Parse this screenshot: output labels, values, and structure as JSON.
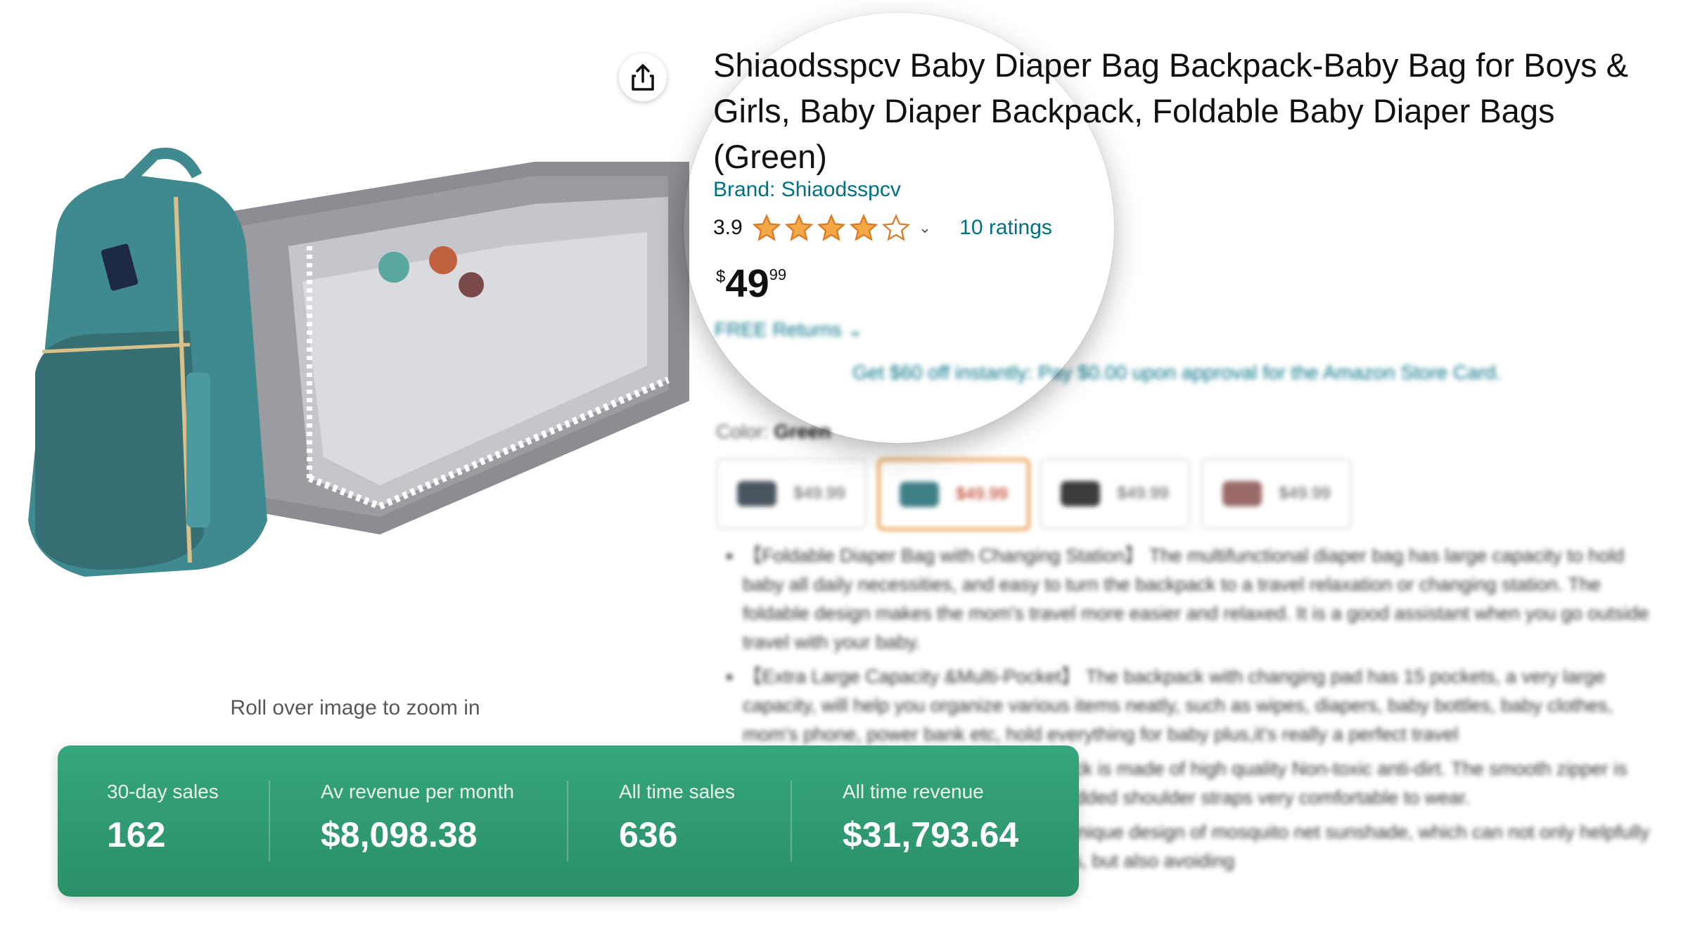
{
  "product": {
    "title": "Shiaodsspcv Baby Diaper Bag Backpack-Baby Bag for Boys & Girls, Baby Diaper Backpack, Foldable Baby Diaper Bags (Green)",
    "brand": "Brand: Shiaodsspcv",
    "rating": {
      "value": "3.9",
      "stars": 3.9,
      "ratings_count": "10 ratings",
      "caret": "⌄"
    },
    "price": {
      "symbol": "$",
      "whole": "49",
      "fraction": "99"
    },
    "free_returns": "FREE Returns ⌄",
    "store_card_offer": "Get $60 off instantly: Pay $0.00 upon approval for the Amazon Store Card.",
    "color_label": "Color:",
    "color_value": "Green",
    "swatches": [
      {
        "price": "$49.99",
        "color": "#4a5560",
        "selected": false
      },
      {
        "price": "$49.99",
        "color": "#3f7f86",
        "selected": true
      },
      {
        "price": "$49.99",
        "color": "#3c3c3c",
        "selected": false
      },
      {
        "price": "$49.99",
        "color": "#9a6a6a",
        "selected": false
      }
    ],
    "bullets": [
      "【Foldable Diaper Bag with Changing Station】 The multifunctional diaper bag has large capacity to hold baby all daily necessities, and easy to turn the backpack to a travel relaxation or changing station. The foldable design makes the mom's travel more easier and relaxed. It is a good assistant when you go outside travel with your baby.",
      "【Extra Large Capacity &Multi-Pocket】 The backpack with changing pad has 15 pockets, a very large capacity, will help you organize various items neatly, such as wipes, diapers, baby bottles, baby clothes, mom's phone, power bank etc, hold everything for baby plus,it's really a perfect travel",
      "【Waterproof】 The diaper bag backpack is made of high quality Non-toxic anti-dirt. The smooth zipper is convenient for you to open and back padded shoulder straps very comfortable to wear.",
      "【Sunshade】 - Our diaper bag has a unique design of mosquito net sunshade, which can not only helpfully protect your baby's eyes from sun's rays, but also avoiding"
    ],
    "zoom_hint": "Roll over image to zoom in"
  },
  "colors": {
    "link": "#007185",
    "star": "#f3a847",
    "panel_green": "#2e9a70",
    "selected_border": "#e77600"
  },
  "icons": {
    "share": "share-icon",
    "star": "star-icon"
  },
  "stats": [
    {
      "label": "30-day sales",
      "value": "162"
    },
    {
      "label": "Av revenue per month",
      "value": "$8,098.38"
    },
    {
      "label": "All time sales",
      "value": "636"
    },
    {
      "label": "All time revenue",
      "value": "$31,793.64"
    }
  ]
}
